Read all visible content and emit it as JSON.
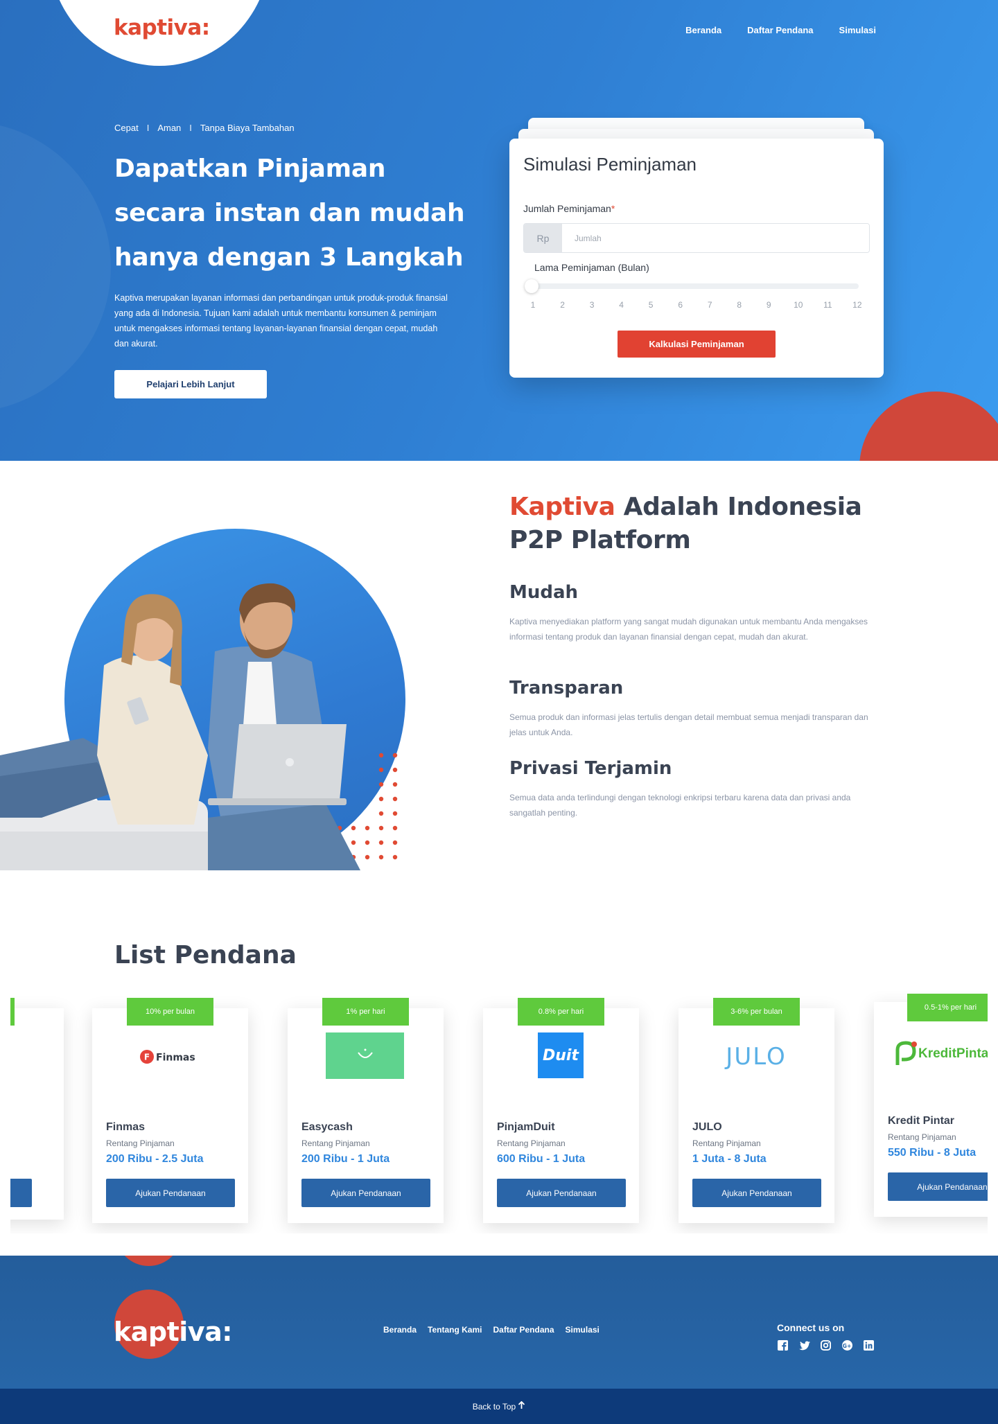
{
  "brand": {
    "name": "kaptiva:",
    "accent": "#e04a33",
    "primary": "#2a6fbf"
  },
  "nav": {
    "items": [
      "Beranda",
      "Daftar Pendana",
      "Simulasi"
    ]
  },
  "hero": {
    "tagline": [
      "Cepat",
      "Aman",
      "Tanpa Biaya Tambahan"
    ],
    "tagline_separator": "I",
    "title": "Dapatkan Pinjaman secara instan dan mudah hanya dengan 3 Langkah",
    "description": "Kaptiva merupakan layanan informasi dan perbandingan untuk produk-produk finansial yang ada di Indonesia. Tujuan kami adalah untuk membantu konsumen & peminjam untuk mengakses informasi tentang layanan-layanan finansial dengan cepat, mudah dan akurat.",
    "cta": "Pelajari Lebih Lanjut"
  },
  "simulation": {
    "title": "Simulasi Peminjaman",
    "amount_label": "Jumlah Peminjaman",
    "required_mark": "*",
    "currency_prefix": "Rp",
    "amount_placeholder": "Jumlah",
    "amount_value": "",
    "duration_label": "Lama Peminjaman (Bulan)",
    "duration_ticks": [
      "1",
      "2",
      "3",
      "4",
      "5",
      "6",
      "7",
      "8",
      "9",
      "10",
      "11",
      "12"
    ],
    "duration_selected": 1,
    "button": "Kalkulasi Peminjaman"
  },
  "about": {
    "heading_brand": "Kaptiva",
    "heading_rest": " Adalah Indonesia P2P Platform",
    "features": [
      {
        "title": "Mudah",
        "desc": "Kaptiva menyediakan platform yang sangat mudah digunakan untuk membantu Anda mengakses informasi tentang produk dan layanan finansial dengan cepat, mudah dan akurat."
      },
      {
        "title": "Transparan",
        "desc": "Semua produk dan informasi jelas tertulis dengan detail membuat semua menjadi transparan dan jelas untuk Anda."
      },
      {
        "title": "Privasi Terjamin",
        "desc": "Semua data anda terlindungi dengan teknologi enkripsi terbaru karena data dan privasi anda sangatlah penting."
      }
    ]
  },
  "lenders": {
    "title": "List Pendana",
    "sub_label": "Rentang Pinjaman",
    "button": "Ajukan Pendanaan",
    "items": [
      {
        "name": "Finmas",
        "rate": "10% per bulan",
        "range": "200 Ribu - 2.5 Juta",
        "logo_text": "Finmas"
      },
      {
        "name": "Easycash",
        "rate": "1% per hari",
        "range": "200 Ribu - 1 Juta",
        "logo_text": ""
      },
      {
        "name": "PinjamDuit",
        "rate": "0.8% per hari",
        "range": "600 Ribu - 1 Juta",
        "logo_text": "Duit"
      },
      {
        "name": "JULO",
        "rate": "3-6% per bulan",
        "range": "1 Juta - 8 Juta",
        "logo_text": "JULO"
      },
      {
        "name": "Kredit Pintar",
        "rate": "0.5-1% per hari",
        "range": "550 Ribu - 8 Juta",
        "logo_text": "KreditPintar"
      }
    ]
  },
  "footer": {
    "logo": "kaptiva:",
    "nav": [
      "Beranda",
      "Tentang Kami",
      "Daftar Pendana",
      "Simulasi"
    ],
    "connect": "Connect us on",
    "social": [
      "facebook-icon",
      "twitter-icon",
      "instagram-icon",
      "google-plus-icon",
      "linkedin-icon"
    ],
    "back_to_top": "Back to Top"
  }
}
